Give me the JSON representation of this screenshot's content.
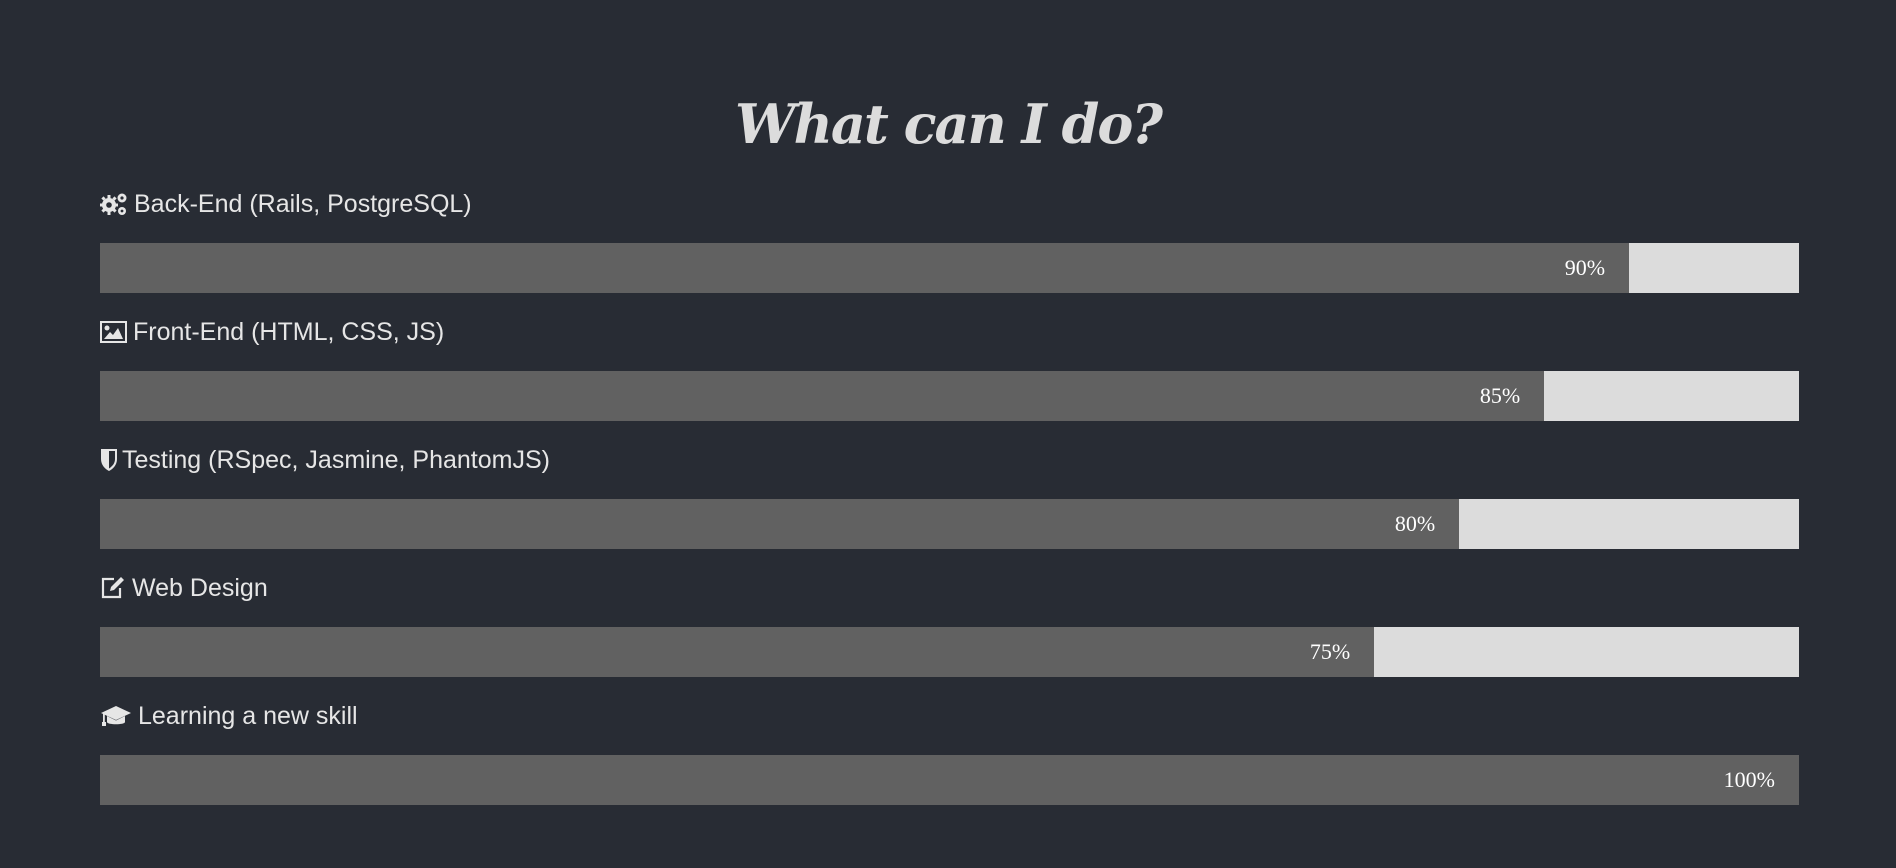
{
  "title": "What can I do?",
  "skills": [
    {
      "label": "Back-End (Rails, PostgreSQL)",
      "icon": "gears-icon",
      "percent_label": "90%",
      "percent": 90
    },
    {
      "label": "Front-End (HTML, CSS, JS)",
      "icon": "image-icon",
      "percent_label": "85%",
      "percent": 85
    },
    {
      "label": "Testing (RSpec, Jasmine, PhantomJS)",
      "icon": "shield-icon",
      "percent_label": "80%",
      "percent": 80
    },
    {
      "label": "Web Design",
      "icon": "edit-icon",
      "percent_label": "75%",
      "percent": 75
    },
    {
      "label": "Learning a new skill",
      "icon": "graduation-cap-icon",
      "percent_label": "100%",
      "percent": 100
    }
  ],
  "colors": {
    "background": "#282c34",
    "bar_fill": "#616161",
    "bar_track": "#dcdcdc",
    "text": "#e6e6e6"
  }
}
